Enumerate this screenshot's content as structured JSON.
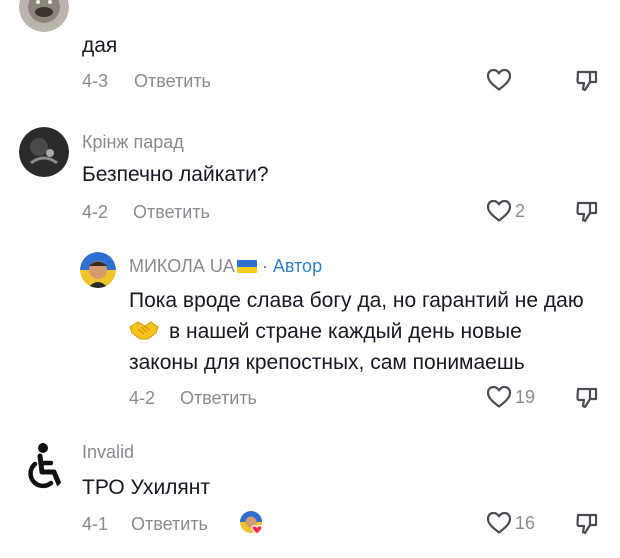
{
  "comments": [
    {
      "username": "",
      "text": "дая",
      "date": "4-3",
      "reply_label": "Ответить",
      "like_count": "",
      "icons": {
        "avatar": "avatar-icon",
        "like": "heart-icon",
        "dislike": "thumbs-down-icon"
      }
    },
    {
      "username": "Крінж парад",
      "text": "Безпечно лайкати?",
      "date": "4-2",
      "reply_label": "Ответить",
      "like_count": "2",
      "icons": {
        "avatar": "avatar-icon",
        "like": "heart-icon",
        "dislike": "thumbs-down-icon"
      }
    },
    {
      "username": "МИКОЛА UA",
      "author_tag": " · Автор",
      "text_lines": [
        "Пока вроде слава богу да, но гарантий не даю",
        "в нашей стране каждый день новые",
        "законы для крепостных, сам понимаешь"
      ],
      "date": "4-2",
      "reply_label": "Ответить",
      "like_count": "19",
      "icons": {
        "avatar": "avatar-icon",
        "flag": "ukraine-flag-icon",
        "emoji": "handshake-emoji-icon",
        "like": "heart-icon",
        "dislike": "thumbs-down-icon"
      }
    },
    {
      "username": "Invalid",
      "text": "ТРО Ухилянт",
      "date": "4-1",
      "reply_label": "Ответить",
      "like_count": "16",
      "icons": {
        "avatar": "wheelchair-icon",
        "creator_liked": "creator-liked-avatar-icon",
        "like": "heart-icon",
        "dislike": "thumbs-down-icon"
      }
    }
  ],
  "colors": {
    "primary_text": "#161823",
    "secondary_text": "#8a8b91",
    "author_accent": "#2f82c8"
  }
}
